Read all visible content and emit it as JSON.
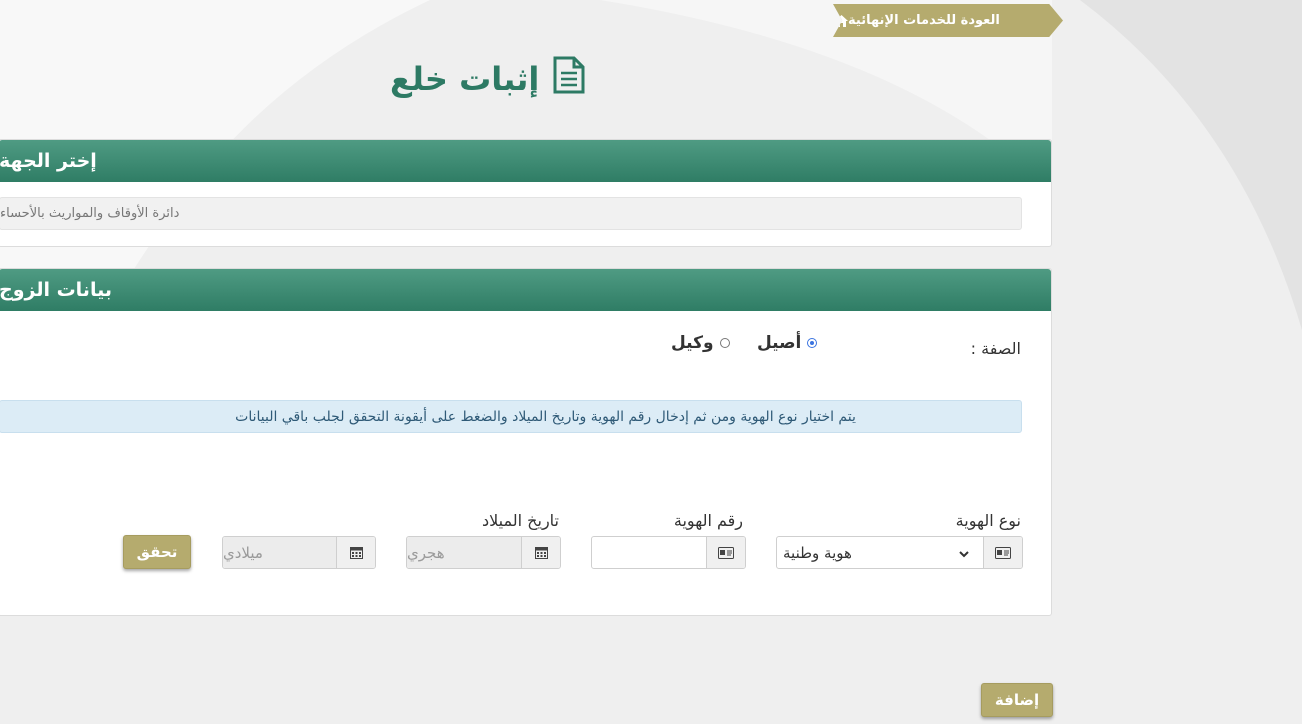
{
  "breadcrumb": {
    "back_label": "العودة للخدمات الإنهائية",
    "icon": "home-icon"
  },
  "page_title": "إثبات خلع",
  "page_icon": "document-icon",
  "agency_section": {
    "title": "إختر الجهة",
    "selected_value": "دائرة الأوقاف والمواريث بالأحساء"
  },
  "husband_section": {
    "title": "بيانات الزوج",
    "role_label": "الصفة :",
    "role_options": [
      {
        "label": "أصيل",
        "checked": true
      },
      {
        "label": "وكيل",
        "checked": false
      }
    ],
    "info_message": "يتم اختيار نوع الهوية ومن ثم إدخال رقم الهوية وتاريخ الميلاد والضغط على أيقونة التحقق لجلب باقي البيانات",
    "id_type": {
      "label": "نوع الهوية",
      "value": "هوية وطنية"
    },
    "id_number": {
      "label": "رقم الهوية",
      "value": ""
    },
    "birth_date": {
      "label": "تاريخ الميلاد",
      "hijri_placeholder": "هجري",
      "gregorian_placeholder": "ميلادي"
    },
    "verify_button": "تحقق"
  },
  "add_button": "إضافة",
  "colors": {
    "header_green": "#2f7d65",
    "olive": "#b5ab6e",
    "title_green": "#2d7a64",
    "info_bg": "#dcecf6"
  }
}
